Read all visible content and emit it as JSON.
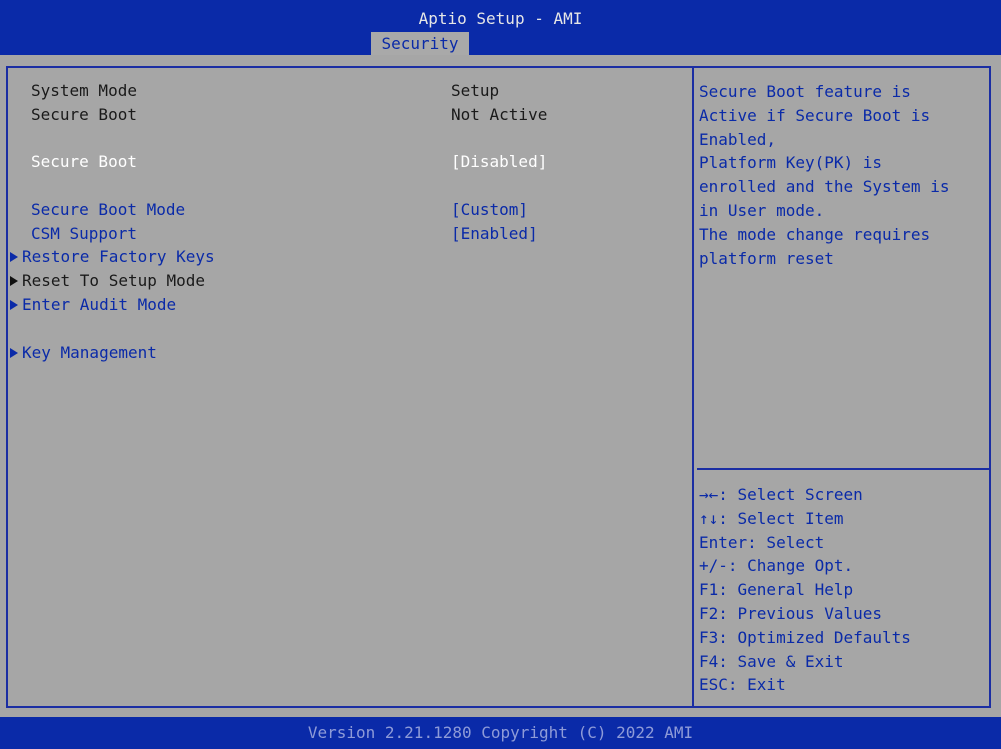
{
  "header": {
    "title": "Aptio Setup - AMI",
    "active_tab": "Security"
  },
  "colors": {
    "header_bg": "#0a2aa8",
    "panel_bg": "#a6a6a6",
    "option_text": "#0a2aa8",
    "static_text": "#1a1a1a",
    "selected_text": "#ffffff"
  },
  "main": {
    "system_mode": {
      "label": "System Mode",
      "value": "Setup"
    },
    "secure_boot_status": {
      "label": "Secure Boot",
      "value": "Not Active"
    },
    "secure_boot_option": {
      "label": "Secure Boot",
      "value": "[Disabled]"
    },
    "secure_boot_mode": {
      "label": "Secure Boot Mode",
      "value": "[Custom]"
    },
    "csm_support": {
      "label": "CSM Support",
      "value": "[Enabled]"
    },
    "submenus": {
      "restore_factory_keys": "Restore Factory Keys",
      "reset_to_setup_mode": "Reset To Setup Mode",
      "enter_audit_mode": "Enter Audit Mode",
      "key_management": "Key Management"
    }
  },
  "help": {
    "lines": [
      "Secure Boot feature is",
      "Active if Secure Boot is",
      "Enabled,",
      "Platform Key(PK) is",
      "enrolled and the System is",
      "in User mode.",
      "The mode change requires",
      "platform reset"
    ]
  },
  "keys": [
    "→←: Select Screen",
    "↑↓: Select Item",
    "Enter: Select",
    "+/-: Change Opt.",
    "F1: General Help",
    "F2: Previous Values",
    "F3: Optimized Defaults",
    "F4: Save & Exit",
    "ESC: Exit"
  ],
  "footer": {
    "version": "Version 2.21.1280 Copyright (C) 2022 AMI"
  }
}
